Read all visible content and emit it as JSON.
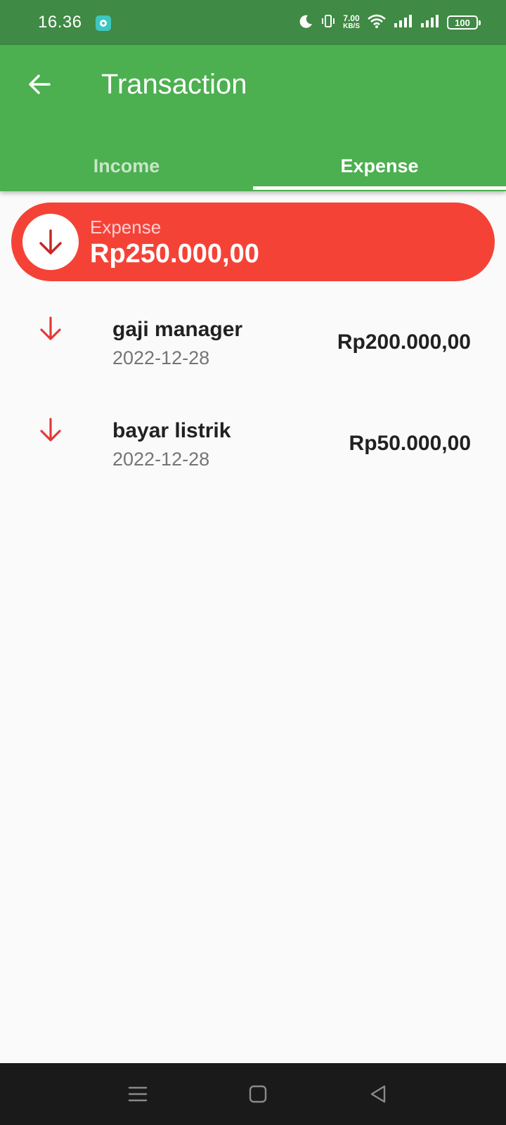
{
  "status_bar": {
    "time": "16.36",
    "speed_value": "7.00",
    "speed_unit": "KB/S",
    "battery": "100"
  },
  "app_bar": {
    "title": "Transaction",
    "tabs": [
      {
        "label": "Income",
        "active": false
      },
      {
        "label": "Expense",
        "active": true
      }
    ]
  },
  "summary": {
    "label": "Expense",
    "amount": "Rp250.000,00"
  },
  "transactions": [
    {
      "name": "gaji manager",
      "date": "2022-12-28",
      "amount": "Rp200.000,00"
    },
    {
      "name": "bayar listrik",
      "date": "2022-12-28",
      "amount": "Rp50.000,00"
    }
  ],
  "colors": {
    "status_bar": "#3f8a44",
    "app_bar": "#4caf50",
    "expense": "#f44336",
    "arrow": "#e53935"
  }
}
